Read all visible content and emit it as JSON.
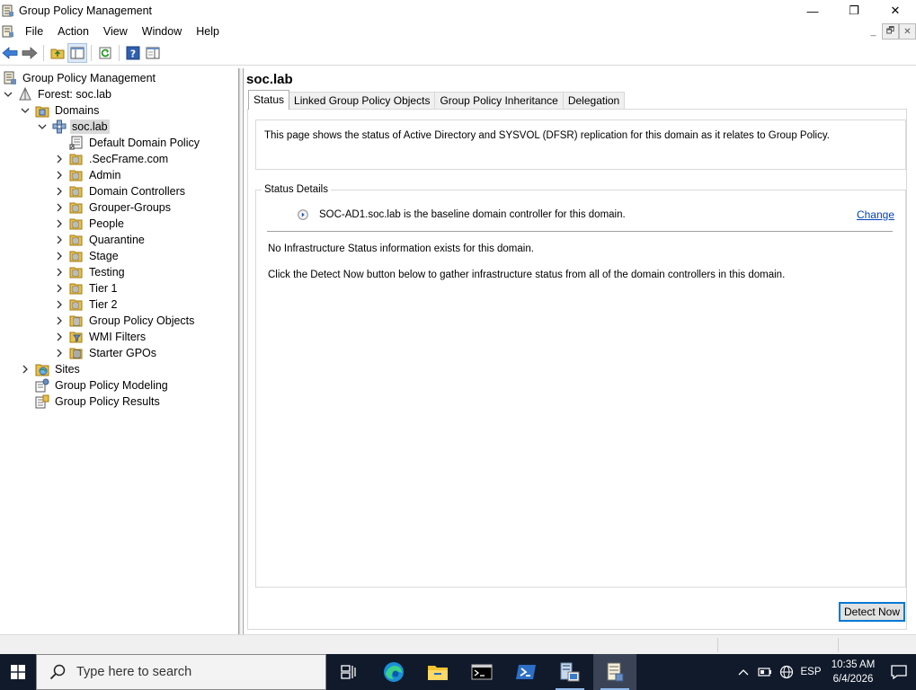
{
  "window": {
    "title": "Group Policy Management",
    "minimize": "—",
    "maximize": "❐",
    "close": "✕"
  },
  "menu": {
    "items": [
      "File",
      "Action",
      "View",
      "Window",
      "Help"
    ],
    "mdi_min": "_",
    "mdi_restore": "🗗",
    "mdi_close": "✕"
  },
  "tree": {
    "root": "Group Policy Management",
    "forest": "Forest: soc.lab",
    "domains": "Domains",
    "domain": "soc.lab",
    "children": [
      "Default Domain Policy",
      ".SecFrame.com",
      "Admin",
      "Domain Controllers",
      "Grouper-Groups",
      "People",
      "Quarantine",
      "Stage",
      "Testing",
      "Tier 1",
      "Tier 2",
      "Group Policy Objects",
      "WMI Filters",
      "Starter GPOs"
    ],
    "sites": "Sites",
    "modeling": "Group Policy Modeling",
    "results": "Group Policy Results"
  },
  "right": {
    "title": "soc.lab",
    "tabs": [
      "Status",
      "Linked Group Policy Objects",
      "Group Policy Inheritance",
      "Delegation"
    ],
    "active_tab": "Status",
    "info_text": "This page shows the status of Active Directory and SYSVOL (DFSR) replication for this domain as it relates to Group Policy.",
    "status_details_label": "Status Details",
    "baseline_text": "SOC-AD1.soc.lab is the baseline domain controller for this domain.",
    "change_link": "Change",
    "no_info_text": "No Infrastructure Status information exists for this domain.",
    "click_detect_text": "Click the Detect Now button below to gather infrastructure status from all of the domain controllers in this domain.",
    "detect_button": "Detect Now"
  },
  "taskbar": {
    "search_placeholder": "Type here to search",
    "language": "ESP",
    "time": "10:35 AM",
    "date": "6/4/2026"
  },
  "colors": {
    "taskbar_bg": "#101a2b",
    "link": "#0044bb",
    "accent": "#0078d7",
    "selection": "#d9d9d9"
  }
}
